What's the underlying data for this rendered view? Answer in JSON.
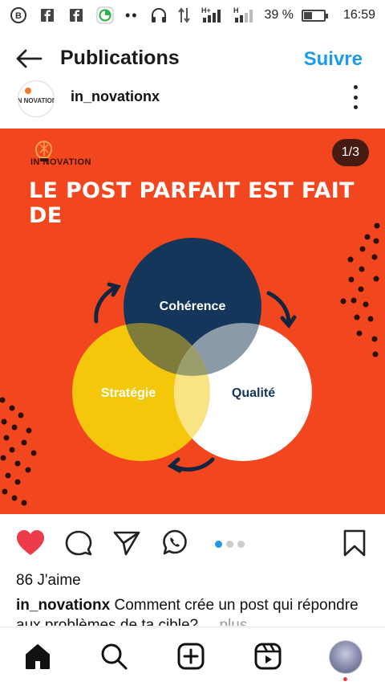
{
  "status_bar": {
    "signal_4g": "H+",
    "signal_2": "H",
    "battery": "39 %",
    "battery_level": 0.39,
    "time": "16:59",
    "icons": [
      "b-circle-icon",
      "facebook-icon",
      "facebook-icon",
      "data-saver-icon",
      "more-notifications-icon",
      "headphones-icon",
      "data-transfer-icon",
      "signal-icon",
      "signal-icon",
      "battery-icon"
    ]
  },
  "header": {
    "title": "Publications",
    "follow_label": "Suivre"
  },
  "post": {
    "username": "in_novationx",
    "counter": "1/3",
    "image": {
      "brand": "IN NOVATION",
      "heading": "LE POST PARFAIT EST FAIT DE",
      "circles": [
        {
          "label": "Cohérence",
          "color": "#13365a"
        },
        {
          "label": "Stratégie",
          "color": "#f4c70a"
        },
        {
          "label": "Qualité",
          "color": "#ffffff"
        }
      ],
      "background": "#f2461e"
    },
    "carousel": {
      "count": 3,
      "active": 0
    },
    "likes": "86 J'aime",
    "caption_user": "in_novationx",
    "caption_text": "Comment crée un post qui répondre aux problèmes de ta cible?",
    "caption_more": "... plus",
    "like_color": "#ed3b4a"
  },
  "colors": {
    "accent": "#1e9be8"
  }
}
